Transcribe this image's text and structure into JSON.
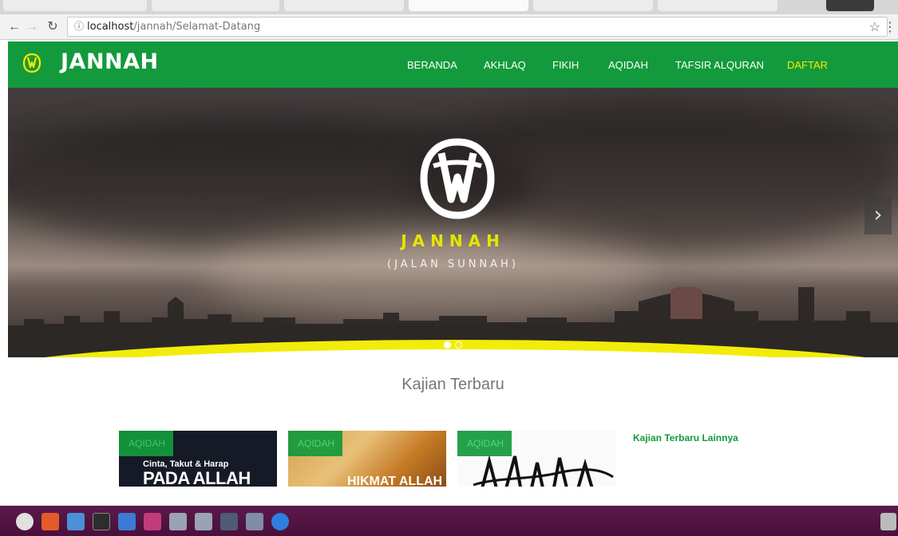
{
  "browser": {
    "url_host": "localhost",
    "url_path": "/jannah/Selamat-Datang"
  },
  "site": {
    "brand": "JANNAH",
    "nav": [
      "BERANDA",
      "AKHLAQ",
      "FIKIH",
      "AQIDAH",
      "TAFSIR ALQURAN",
      "DAFTAR"
    ],
    "active_nav": "DAFTAR"
  },
  "hero": {
    "title": "JANNAH",
    "subtitle": "(JALAN SUNNAH)"
  },
  "section": {
    "title": "Kajian Terbaru",
    "more_link": "Kajian Terbaru Lainnya"
  },
  "cards": [
    {
      "badge": "AQIDAH",
      "line1": "Cinta, Takut & Harap",
      "line2": "PADA ALLAH"
    },
    {
      "badge": "AQIDAH",
      "line1": "HIKMAT ALLAH"
    },
    {
      "badge": "AQIDAH"
    }
  ],
  "colors": {
    "brand_green": "#139a3c",
    "accent_yellow": "#ffe600",
    "hero_wave": "#f3ec0a",
    "taskbar": "#4a0f3b"
  },
  "icons": {
    "back": "arrow-left-icon",
    "forward": "arrow-right-icon",
    "reload": "reload-icon",
    "info": "info-icon",
    "bookmark": "star-icon",
    "menu": "menu-dots-icon",
    "brand": "jannah-logo-icon",
    "next": "chevron-right-icon"
  }
}
